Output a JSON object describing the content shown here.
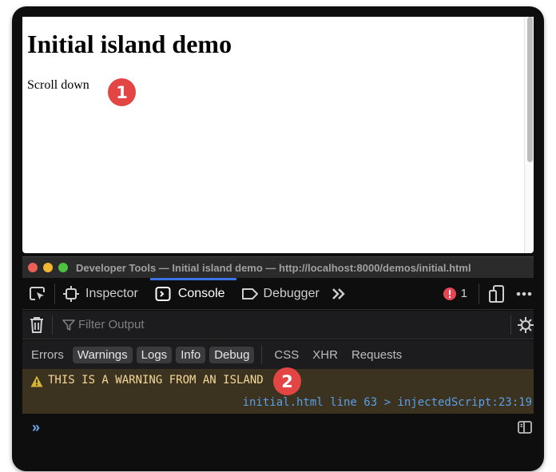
{
  "page": {
    "heading": "Initial island demo",
    "paragraph": "Scroll down"
  },
  "annotations": [
    {
      "label": "1",
      "color": "#e34444"
    },
    {
      "label": "2",
      "color": "#e34444"
    }
  ],
  "devtools": {
    "window_title": "Developer Tools — Initial island demo — http://localhost:8000/demos/initial.html",
    "tabs": [
      {
        "label": "Inspector",
        "icon": "inspector-icon",
        "active": false
      },
      {
        "label": "Console",
        "icon": "console-icon",
        "active": true
      },
      {
        "label": "Debugger",
        "icon": "debugger-icon",
        "active": false
      }
    ],
    "more_tabs_icon": "chevron-double-right-icon",
    "error_count": "1",
    "filter": {
      "placeholder": "Filter Output",
      "value": ""
    },
    "levels": [
      {
        "label": "Errors",
        "enabled": false
      },
      {
        "label": "Warnings",
        "enabled": true
      },
      {
        "label": "Logs",
        "enabled": true
      },
      {
        "label": "Info",
        "enabled": true
      },
      {
        "label": "Debug",
        "enabled": true
      }
    ],
    "categories": [
      {
        "label": "CSS"
      },
      {
        "label": "XHR"
      },
      {
        "label": "Requests"
      }
    ],
    "messages": [
      {
        "level": "warning",
        "text": "THIS IS A WARNING FROM AN ISLAND",
        "source": "initial.html line 63 > injectedScript:23:19"
      }
    ],
    "prompt_symbol": "»",
    "colors": {
      "accent": "#3a73e6",
      "warning_bg": "#3b3320",
      "warning_text": "#f5d89a",
      "link": "#5a9fe8",
      "error_badge": "#e64553"
    }
  }
}
